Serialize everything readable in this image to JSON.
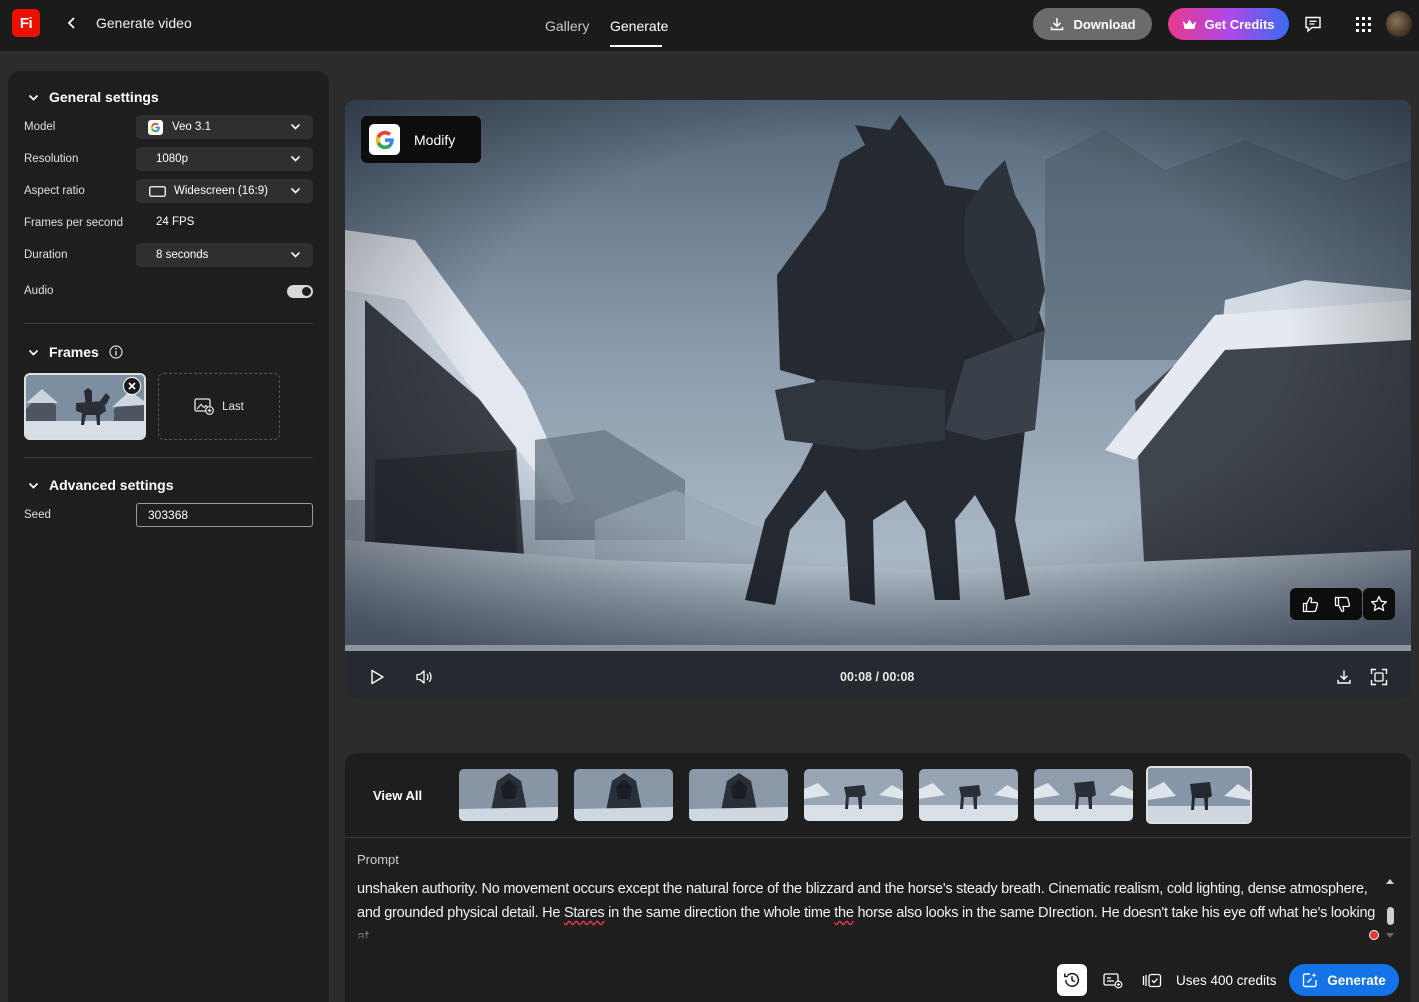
{
  "header": {
    "logo_text": "Fi",
    "title": "Generate video",
    "tabs": [
      {
        "label": "Gallery",
        "active": false
      },
      {
        "label": "Generate",
        "active": true
      }
    ],
    "download_label": "Download",
    "get_credits_label": "Get Credits",
    "icons": [
      "download-icon",
      "crown-icon",
      "feedback-icon",
      "apps-grid-icon",
      "avatar"
    ]
  },
  "general_settings": {
    "title": "General settings",
    "model_label": "Model",
    "model_value": "Veo 3.1",
    "resolution_label": "Resolution",
    "resolution_value": "1080p",
    "aspect_label": "Aspect ratio",
    "aspect_value": "Widescreen (16:9)",
    "fps_label": "Frames per second",
    "fps_value": "24 FPS",
    "duration_label": "Duration",
    "duration_value": "8 seconds",
    "audio_label": "Audio",
    "audio_on": true
  },
  "frames": {
    "title": "Frames",
    "last_label": "Last"
  },
  "advanced_settings": {
    "title": "Advanced settings",
    "seed_label": "Seed",
    "seed_value": "303368"
  },
  "video": {
    "badge_label": "Modify",
    "time": "00:08 / 00:08",
    "progress": 1.0
  },
  "history": {
    "view_all_label": "View All",
    "thumb_count": 7,
    "selected_index": 6
  },
  "prompt": {
    "label": "Prompt",
    "text_1": "unshaken authority. No movement occurs except the natural force of the blizzard and the horse's steady breath. Cinematic realism, cold lighting, dense atmosphere, and grounded physical detail. He ",
    "misspelled_1": "Stares",
    "text_2": " in the same direction the whole time ",
    "misspelled_2": "the",
    "text_3": " horse also looks in the same DIrection. He doesn't take his eye off what he's looking at.",
    "credits_text": "Uses 400 credits",
    "generate_label": "Generate"
  },
  "colors": {
    "accent_blue": "#1473e6",
    "brand_red": "#eb1000",
    "credits_gradient_start": "#e8388a",
    "credits_gradient_end": "#3a6cf0"
  }
}
